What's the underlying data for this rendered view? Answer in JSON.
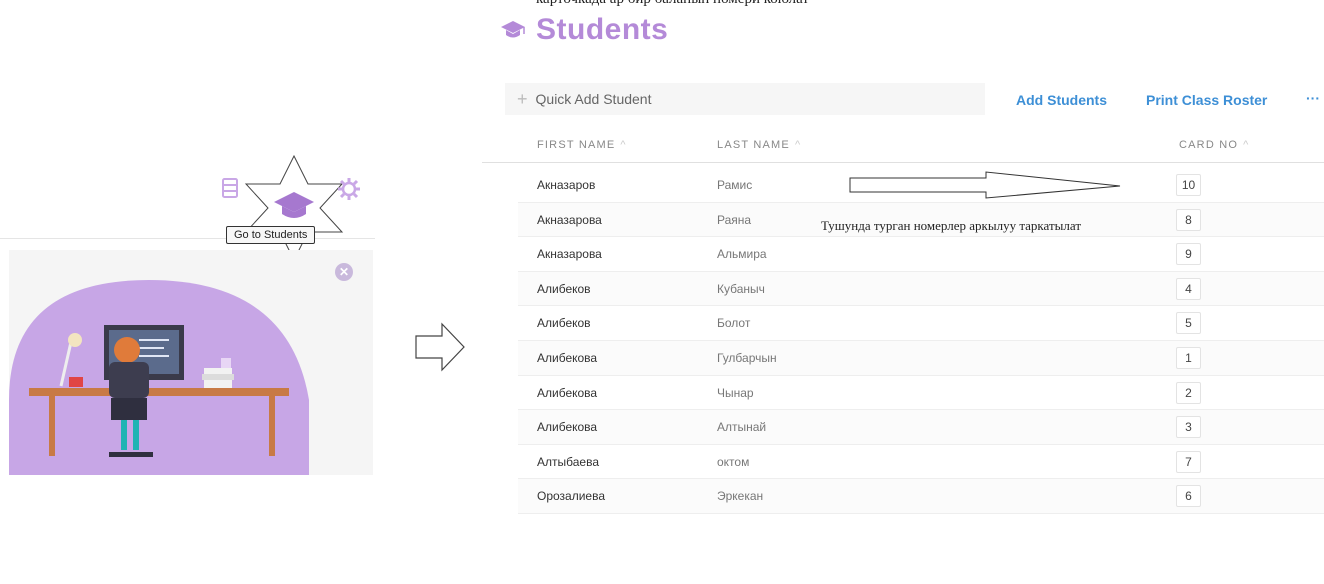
{
  "top_caption": "карточкада ар бир баланын номери коюлат",
  "page": {
    "title": "Students"
  },
  "left": {
    "tooltip": "Go to Students",
    "icons": [
      "roster-icon",
      "students-cap-icon",
      "settings-gear-icon"
    ]
  },
  "toolbar": {
    "quick_add_placeholder": "Quick Add Student",
    "add_students": "Add Students",
    "print_roster": "Print Class Roster",
    "more": "···"
  },
  "table": {
    "headers": {
      "first": "FIRST NAME",
      "last": "LAST NAME",
      "card": "CARD NO"
    },
    "sort_glyph": "^",
    "rows": [
      {
        "first": "Акназаров",
        "last": "Рамис",
        "card": "10"
      },
      {
        "first": "Акназарова",
        "last": "Раяна",
        "card": "8"
      },
      {
        "first": "Акназарова",
        "last": "Альмира",
        "card": "9"
      },
      {
        "first": "Алибеков",
        "last": "Кубаныч",
        "card": "4"
      },
      {
        "first": "Алибеков",
        "last": "Болот",
        "card": "5"
      },
      {
        "first": "Алибекова",
        "last": "Гулбарчын",
        "card": "1"
      },
      {
        "first": "Алибекова",
        "last": "Чынар",
        "card": "2"
      },
      {
        "first": "Алибекова",
        "last": "Алтынай",
        "card": "3"
      },
      {
        "first": "Алтыбаева",
        "last": "октом",
        "card": "7"
      },
      {
        "first": "Орозалиева",
        "last": "Эркекан",
        "card": "6"
      }
    ]
  },
  "annotation": {
    "text": "Тушунда турган номерлер аркылуу таркатылат"
  },
  "colors": {
    "accent": "#b48ad8",
    "link": "#3d8fd6",
    "promo_bg": "#c7a6e6"
  }
}
